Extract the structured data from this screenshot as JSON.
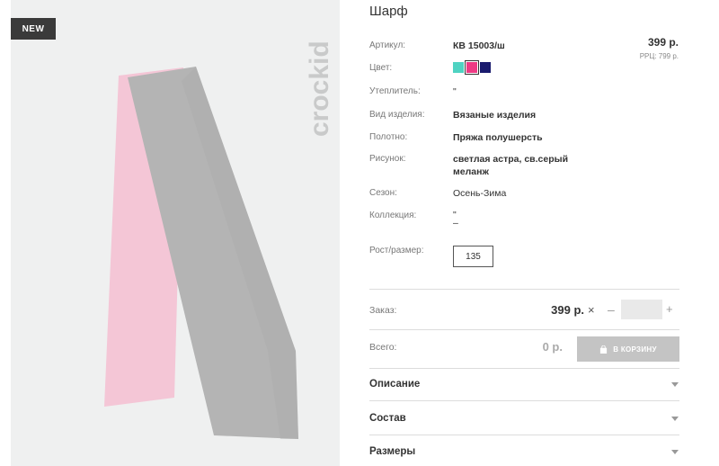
{
  "badge": {
    "label": "NEW"
  },
  "brand": {
    "name": "crockid"
  },
  "colors": {
    "scarf_pink": "#f4c6d6",
    "scarf_grey": "#b4b4b4",
    "image_bg": "#eff0f0",
    "swatch_turquoise": "#4fd3c2",
    "swatch_pink": "#ee3a84",
    "swatch_navy": "#1a1b6e",
    "cart_button": "#c4c4c4"
  },
  "product": {
    "title": "Шарф",
    "price": "399 р.",
    "rrc": "РРЦ: 799 р."
  },
  "attributes": {
    "article": {
      "label": "Артикул:",
      "value": "КВ 15003/ш"
    },
    "color": {
      "label": "Цвет:"
    },
    "insulation": {
      "label": "Утеплитель:",
      "value": "\""
    },
    "kind": {
      "label": "Вид изделия:",
      "value": "Вязаные изделия"
    },
    "fabric": {
      "label": "Полотно:",
      "value": "Пряжа полушерсть"
    },
    "pattern": {
      "label": "Рисунок:",
      "value_line1": "светлая астра, св.серый",
      "value_line2": "меланж"
    },
    "season": {
      "label": "Сезон:",
      "value": "Осень-Зима"
    },
    "collection": {
      "label": "Коллекция:",
      "value_line1": "\"",
      "value_line2": "–"
    },
    "size": {
      "label": "Рост/размер:",
      "value": "135"
    }
  },
  "swatches": [
    {
      "name": "turquoise",
      "selected": false
    },
    {
      "name": "pink",
      "selected": true
    },
    {
      "name": "navy",
      "selected": false
    }
  ],
  "order": {
    "label": "Заказ:",
    "price": "399 р.",
    "times": "×",
    "minus": "–",
    "plus": "+",
    "quantity": ""
  },
  "total": {
    "label": "Всего:",
    "value": "0 р.",
    "cart_button": "В КОРЗИНУ"
  },
  "accordion": [
    {
      "title": "Описание"
    },
    {
      "title": "Состав"
    },
    {
      "title": "Размеры"
    }
  ]
}
